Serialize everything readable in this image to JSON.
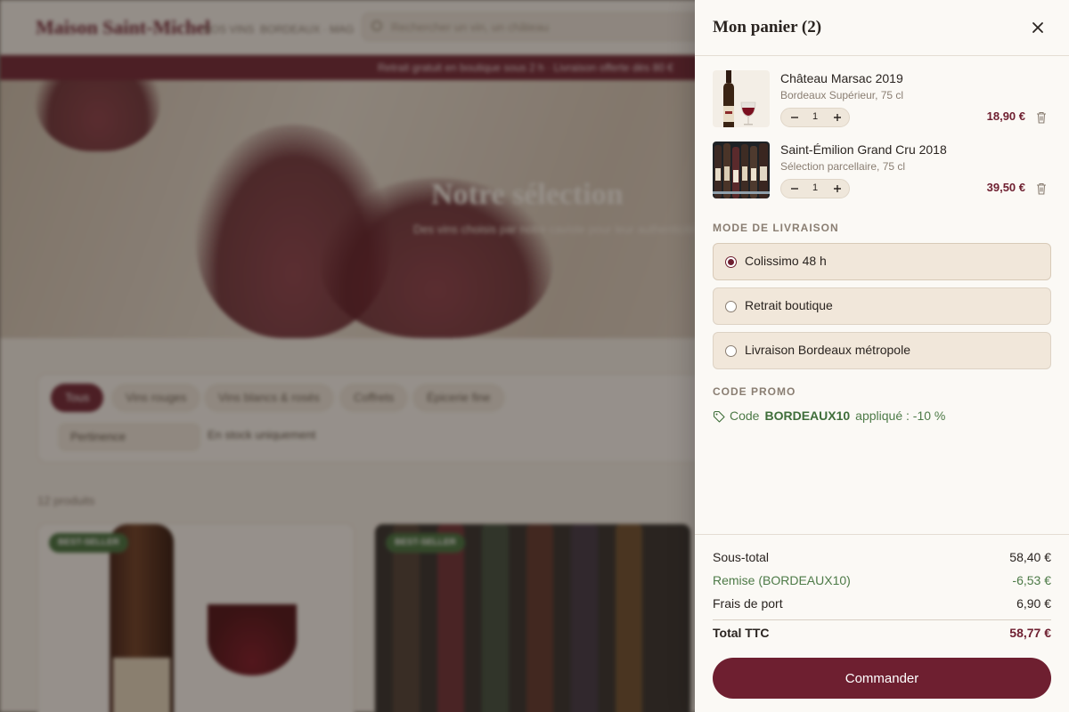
{
  "background_page": {
    "logo": "Maison Saint-Michel",
    "nav": [
      "NOS VINS",
      "BORDEAUX · MAG"
    ],
    "search_placeholder": "Rechercher un vin, un château",
    "banner": "Retrait gratuit en boutique sous 2 h · Livraison offerte dès 80 €",
    "hero_title": "Notre sélection",
    "hero_subtitle": "Des vins choisis par notre caviste pour leur authenticité et leur terroir",
    "filter_tabs": [
      "Tous",
      "Vins rouges",
      "Vins blancs & rosés",
      "Coffrets",
      "Épicerie fine"
    ],
    "sort_select": "Pertinence",
    "in_stock_label": "En stock uniquement",
    "product_count": "12 produits",
    "card_badges": [
      "BEST-SELLER",
      "BEST-SELLER"
    ]
  },
  "cart": {
    "title": "Mon panier (2)",
    "items": [
      {
        "name": "Château Marsac 2019",
        "subtitle": "Bordeaux Supérieur, 75 cl",
        "quantity": "1",
        "price": "18,90 €"
      },
      {
        "name": "Saint-Émilion Grand Cru 2018",
        "subtitle": "Sélection parcellaire, 75 cl",
        "quantity": "1",
        "price": "39,50 €"
      }
    ],
    "shipping": {
      "title": "MODE DE LIVRAISON",
      "options": [
        {
          "label": "Colissimo 48 h",
          "selected": true
        },
        {
          "label": "Retrait boutique",
          "selected": false
        },
        {
          "label": "Livraison Bordeaux métropole",
          "selected": false
        }
      ]
    },
    "promo": {
      "title": "CODE PROMO",
      "prefix": "Code",
      "code": "BORDEAUX10",
      "suffix": "appliqué : -10 %"
    },
    "summary": {
      "subtotal_label": "Sous-total",
      "subtotal_value": "58,40 €",
      "discount_label": "Remise (BORDEAUX10)",
      "discount_value": "-6,53 €",
      "shipping_label": "Frais de port",
      "shipping_value": "6,90 €",
      "total_label": "Total TTC",
      "total_value": "58,77 €"
    },
    "checkout_label": "Commander"
  },
  "colors": {
    "brand": "#6e1f30",
    "promo_green": "#3f6e3a",
    "option_bg": "#f1e7da"
  }
}
